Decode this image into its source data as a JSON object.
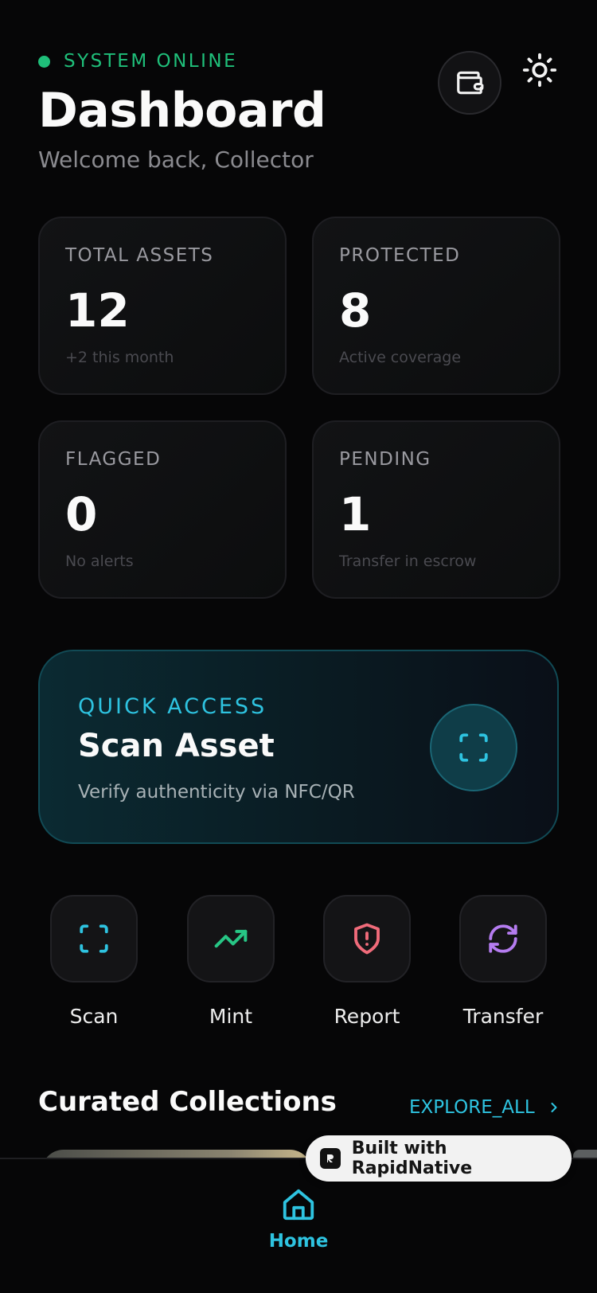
{
  "header": {
    "status_text": "SYSTEM ONLINE",
    "title": "Dashboard",
    "subtitle": "Welcome back, Collector"
  },
  "stats": [
    {
      "label": "TOTAL ASSETS",
      "value": "12",
      "note": "+2 this month"
    },
    {
      "label": "PROTECTED",
      "value": "8",
      "note": "Active coverage"
    },
    {
      "label": "FLAGGED",
      "value": "0",
      "note": "No alerts"
    },
    {
      "label": "PENDING",
      "value": "1",
      "note": "Transfer in escrow"
    }
  ],
  "quick_access": {
    "label": "QUICK ACCESS",
    "title": "Scan Asset",
    "description": "Verify authenticity via NFC/QR"
  },
  "actions": [
    {
      "label": "Scan",
      "icon": "scan-icon",
      "color": "#2ec3e0"
    },
    {
      "label": "Mint",
      "icon": "trending-up-icon",
      "color": "#27c685"
    },
    {
      "label": "Report",
      "icon": "shield-alert-icon",
      "color": "#f06b7a"
    },
    {
      "label": "Transfer",
      "icon": "refresh-icon",
      "color": "#b57cf0"
    }
  ],
  "collections": {
    "title": "Curated Collections",
    "explore_label": "EXPLORE_ALL"
  },
  "nav": {
    "home_label": "Home"
  },
  "badge": {
    "text": "Built with RapidNative"
  },
  "colors": {
    "background": "#060607",
    "accent": "#2ec3e0",
    "online": "#1fbf7a"
  }
}
